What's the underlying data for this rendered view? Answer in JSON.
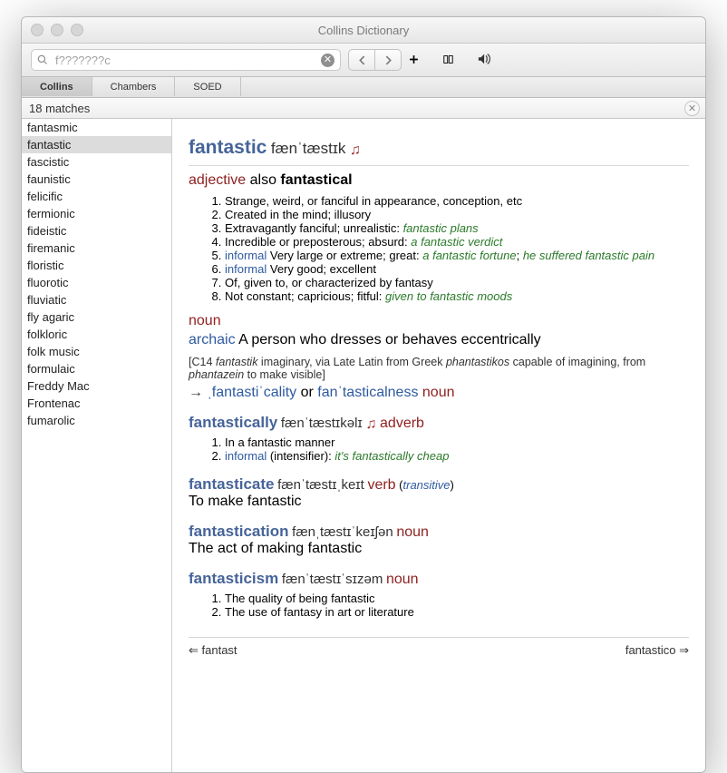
{
  "window": {
    "title": "Collins Dictionary"
  },
  "search": {
    "value": "f???????c"
  },
  "tabs": [
    {
      "label": "Collins",
      "active": true
    },
    {
      "label": "Chambers",
      "active": false
    },
    {
      "label": "SOED",
      "active": false
    }
  ],
  "matches": {
    "count_label": "18 matches"
  },
  "sidebar": [
    "fantasmic",
    "fantastic",
    "fascistic",
    "faunistic",
    "felicific",
    "fermionic",
    "fideistic",
    "firemanic",
    "floristic",
    "fluorotic",
    "fluviatic",
    "fly agaric",
    "folkloric",
    "folk music",
    "formulaic",
    "Freddy Mac",
    "Frontenac",
    "fumarolic"
  ],
  "sidebar_selected": 1,
  "entry": {
    "headword": "fantastic",
    "phon": "fænˈtæstɪk",
    "pos1": "adjective",
    "also": "also",
    "altform": "fantastical",
    "senses": [
      {
        "text": "Strange, weird, or fanciful in appearance, conception, etc"
      },
      {
        "text": "Created in the mind; illusory"
      },
      {
        "text": "Extravagantly fanciful; unrealistic:",
        "ex": "fantastic plans"
      },
      {
        "text": "Incredible or preposterous; absurd:",
        "ex": "a fantastic verdict"
      },
      {
        "label": "informal",
        "text": "Very large or extreme; great:",
        "ex": "a fantastic fortune",
        "ex2": "he suffered fantastic pain"
      },
      {
        "label": "informal",
        "text": "Very good; excellent"
      },
      {
        "text": "Of, given to, or characterized by fantasy"
      },
      {
        "text": "Not constant; capricious; fitful:",
        "ex": "given to fantastic moods"
      }
    ],
    "pos2": "noun",
    "archaic_label": "archaic",
    "noun_def": "A person who dresses or behaves eccentrically",
    "etym": {
      "open": "[C14 ",
      "w1": "fantastik",
      "mid1": " imaginary, via Late Latin from Greek ",
      "w2": "phantastikos",
      "mid2": " capable of imagining, from ",
      "w3": "phantazein",
      "end": " to make visible]"
    },
    "deriv": {
      "arrow": "→",
      "w1": "ˌfantastiˈcality",
      "or": " or ",
      "w2": "fanˈtasticalness",
      "pos": "noun"
    }
  },
  "sub": [
    {
      "hw": "fantastically",
      "ph": "fænˈtæstɪkəlɪ",
      "pos": "adverb",
      "audio": true,
      "senses": [
        {
          "text": "In a fantastic manner"
        },
        {
          "label": "informal",
          "text": "(intensifier):",
          "ex": "it's fantastically cheap"
        }
      ]
    },
    {
      "hw": "fantasticate",
      "ph": "fænˈtæstɪˌkeɪt",
      "pos": "verb",
      "pos_note": "transitive",
      "plain": "To make fantastic"
    },
    {
      "hw": "fantastication",
      "ph": "fænˌtæstɪˈkeɪʃən",
      "pos": "noun",
      "plain": "The act of making fantastic"
    },
    {
      "hw": "fantasticism",
      "ph": "fænˈtæstɪˈsɪzəm",
      "pos": "noun",
      "senses": [
        {
          "text": "The quality of being fantastic"
        },
        {
          "text": "The use of fantasy in art or literature"
        }
      ]
    }
  ],
  "navbottom": {
    "prev": "fantast",
    "next": "fantastico"
  }
}
